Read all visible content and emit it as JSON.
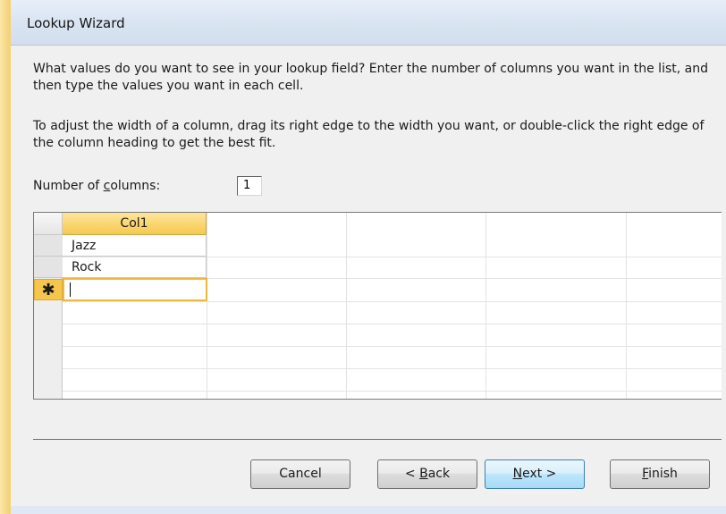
{
  "window": {
    "title": "Lookup Wizard"
  },
  "instructions": {
    "line1": "What values do you want to see in your lookup field? Enter the number of columns you want in the list, and then type the values you want in each cell.",
    "line2": "To adjust the width of a column, drag its right edge to the width you want, or double-click the right edge of the column heading to get the best fit."
  },
  "columns_field": {
    "label_pre": "Number of ",
    "label_ul": "c",
    "label_post": "olumns:",
    "value": "1"
  },
  "grid": {
    "header": "Col1",
    "rows": [
      "Jazz",
      "Rock"
    ],
    "new_row_marker": "✱"
  },
  "buttons": {
    "cancel": "Cancel",
    "back_pre": "< ",
    "back_ul": "B",
    "back_post": "ack",
    "next_ul": "N",
    "next_post": "ext >",
    "finish_ul": "F",
    "finish_post": "inish"
  }
}
